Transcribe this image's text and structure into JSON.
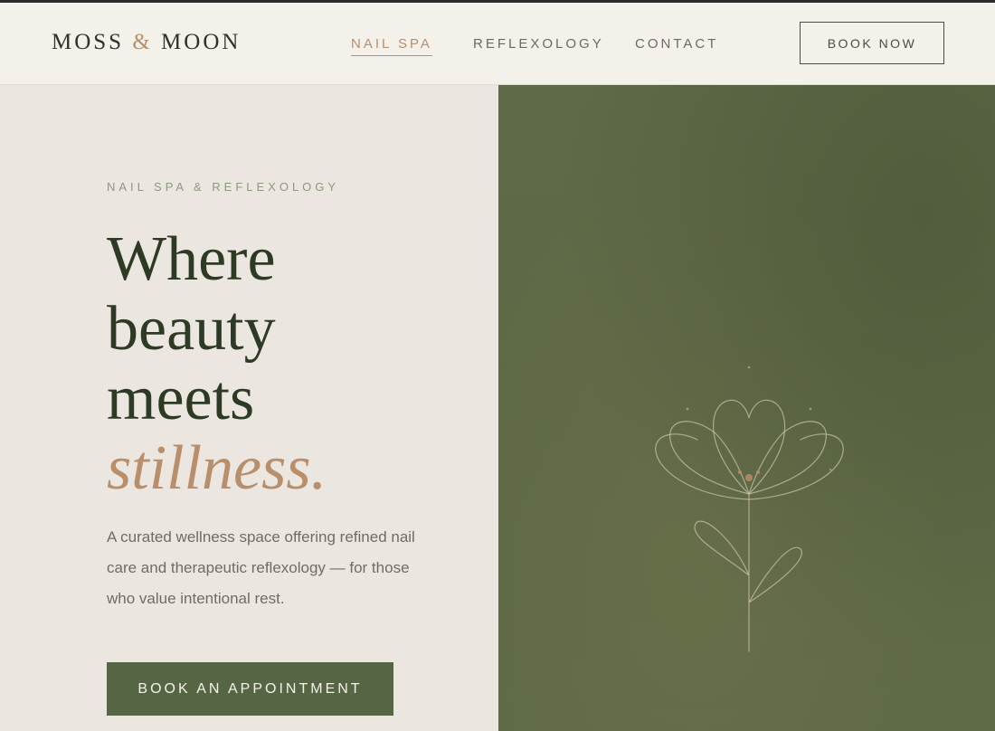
{
  "header": {
    "logo_part1": "MOSS",
    "logo_amp": "&",
    "logo_part2": "MOON",
    "nav": [
      {
        "label": "NAIL SPA",
        "active": true
      },
      {
        "label": "REFLEXOLOGY",
        "active": false
      },
      {
        "label": "CONTACT",
        "active": false
      }
    ],
    "book_now": "BOOK NOW"
  },
  "hero": {
    "eyebrow": "NAIL SPA & REFLEXOLOGY",
    "headline_lines": [
      "Where",
      "beauty",
      "meets"
    ],
    "headline_accent": "stillness.",
    "description": "A curated wellness space offering refined nail care and therapeutic reflexology — for those who value intentional rest.",
    "cta": "BOOK AN APPOINTMENT"
  },
  "illustration": {
    "name": "line-flower-icon"
  },
  "colors": {
    "background": "#ede7e2",
    "header_bg": "#f4f0ea",
    "text_dark": "#2e3b24",
    "accent": "#b98e6b",
    "sage": "#8b9a7c",
    "moss": "#566644",
    "panel_green": "#5f6a48"
  }
}
